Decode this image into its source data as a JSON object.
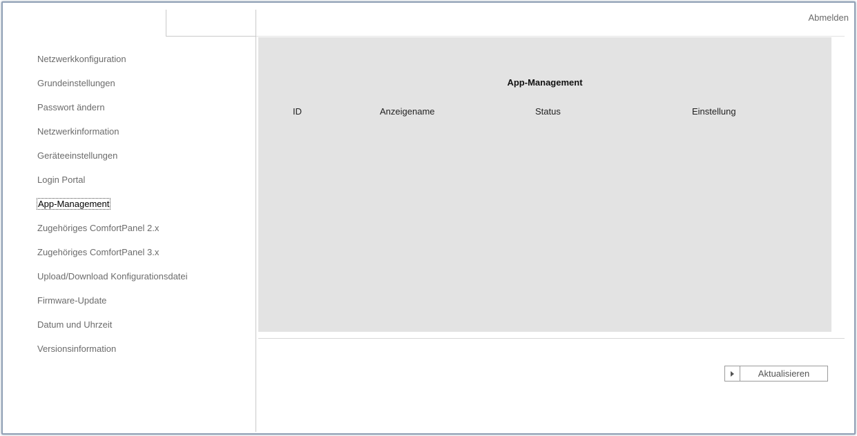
{
  "header": {
    "logout_label": "Abmelden"
  },
  "sidebar": {
    "items": [
      {
        "label": "Netzwerkkonfiguration",
        "active": false
      },
      {
        "label": "Grundeinstellungen",
        "active": false
      },
      {
        "label": "Passwort ändern",
        "active": false
      },
      {
        "label": "Netzwerkinformation",
        "active": false
      },
      {
        "label": "Geräteeinstellungen",
        "active": false
      },
      {
        "label": "Login Portal",
        "active": false
      },
      {
        "label": "App-Management",
        "active": true
      },
      {
        "label": "Zugehöriges ComfortPanel 2.x",
        "active": false
      },
      {
        "label": "Zugehöriges ComfortPanel 3.x",
        "active": false
      },
      {
        "label": "Upload/Download Konfigurationsdatei",
        "active": false
      },
      {
        "label": "Firmware-Update",
        "active": false
      },
      {
        "label": "Datum und Uhrzeit",
        "active": false
      },
      {
        "label": "Versionsinformation",
        "active": false
      }
    ]
  },
  "main": {
    "title": "App-Management",
    "table": {
      "columns": [
        "ID",
        "Anzeigename",
        "Status",
        "Einstellung"
      ],
      "rows": []
    },
    "refresh_label": "Aktualisieren"
  },
  "colors": {
    "panel_bg": "#e3e3e3",
    "frame_border": "#8f9fb5",
    "nav_text": "#6b6b6b"
  }
}
